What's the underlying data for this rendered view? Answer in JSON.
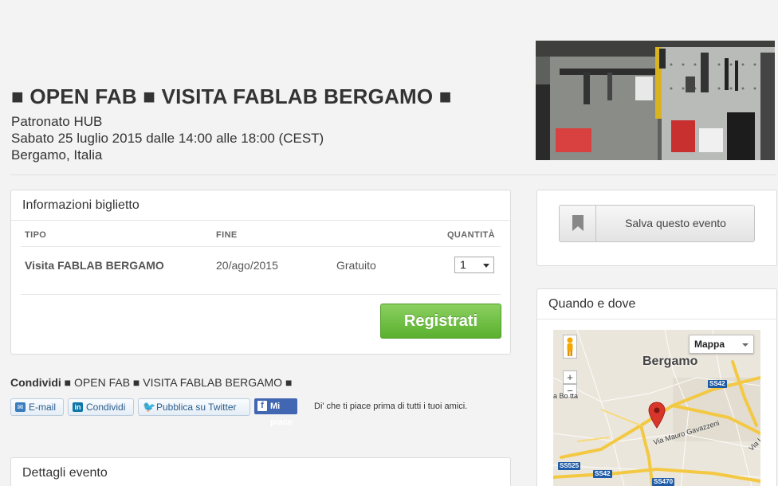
{
  "event": {
    "title": "■ OPEN FAB ■ VISITA FABLAB BERGAMO ■",
    "organizer": "Patronato HUB",
    "datetime": "Sabato 25 luglio 2015 dalle 14:00 alle 18:00 (CEST)",
    "location": "Bergamo, Italia"
  },
  "tickets": {
    "panel_title": "Informazioni biglietto",
    "headers": {
      "type": "TIPO",
      "end": "FINE",
      "quantity": "QUANTITÀ"
    },
    "rows": [
      {
        "type": "Visita FABLAB BERGAMO",
        "end": "20/ago/2015",
        "price": "Gratuito",
        "quantity": "1"
      }
    ],
    "register_label": "Registrati"
  },
  "share": {
    "prefix": "Condividi",
    "text": " ■ OPEN FAB ■ VISITA FABLAB BERGAMO ■",
    "email_label": "E-mail",
    "linkedin_label": "Condividi",
    "twitter_label": "Pubblica su Twitter",
    "fb_like_label": "Mi piace",
    "fb_text": "Di' che ti piace prima di tutti i tuoi amici."
  },
  "details": {
    "panel_title": "Dettagli evento"
  },
  "sidebar": {
    "save_label": "Salva questo evento",
    "where_title": "Quando e dove",
    "map": {
      "type_label": "Mappa",
      "city": "Bergamo",
      "street": "Via Mauro Gavazzeni",
      "partial_label_left": "a Bo     tta",
      "partial_label_right": "Via L",
      "roads": [
        "SS42",
        "SS525",
        "SS42",
        "SS470"
      ],
      "zoom_in": "+",
      "zoom_out": "−"
    }
  },
  "colors": {
    "accent_green": "#6ac03d",
    "facebook_blue": "#4267b2",
    "map_pin": "#d9362b"
  }
}
